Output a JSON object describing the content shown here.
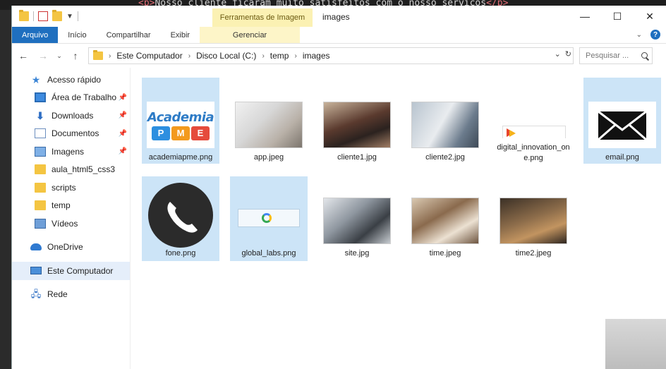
{
  "editor_line": {
    "text": "Nosso cliente ficaram muito satisfeitos com o nosso serviços"
  },
  "window": {
    "title": "images",
    "context_tab_header": "Ferramentas de Imagem"
  },
  "ribbon": {
    "tabs": [
      {
        "label": "Arquivo"
      },
      {
        "label": "Início"
      },
      {
        "label": "Compartilhar"
      },
      {
        "label": "Exibir"
      },
      {
        "label": "Gerenciar"
      }
    ]
  },
  "address": {
    "breadcrumbs": [
      "Este Computador",
      "Disco Local (C:)",
      "temp",
      "images"
    ],
    "search_placeholder": "Pesquisar ..."
  },
  "sidebar": {
    "items": [
      {
        "label": "Acesso rápido",
        "icon": "star-icon",
        "pinned": false
      },
      {
        "label": "Área de Trabalho",
        "icon": "desktop-icon",
        "pinned": true
      },
      {
        "label": "Downloads",
        "icon": "download-icon",
        "pinned": true
      },
      {
        "label": "Documentos",
        "icon": "documents-icon",
        "pinned": true
      },
      {
        "label": "Imagens",
        "icon": "pictures-icon",
        "pinned": true
      },
      {
        "label": "aula_html5_css3",
        "icon": "folder-icon",
        "pinned": false
      },
      {
        "label": "scripts",
        "icon": "folder-icon",
        "pinned": false
      },
      {
        "label": "temp",
        "icon": "folder-icon",
        "pinned": false
      },
      {
        "label": "Vídeos",
        "icon": "videos-icon",
        "pinned": false
      },
      {
        "label": "OneDrive",
        "icon": "cloud-icon",
        "pinned": false
      },
      {
        "label": "Este Computador",
        "icon": "computer-icon",
        "pinned": false
      },
      {
        "label": "Rede",
        "icon": "network-icon",
        "pinned": false
      }
    ]
  },
  "files": [
    {
      "name": "academiapme.png",
      "selected": true
    },
    {
      "name": "app.jpeg",
      "selected": false
    },
    {
      "name": "cliente1.jpg",
      "selected": false
    },
    {
      "name": "cliente2.jpg",
      "selected": false
    },
    {
      "name": "digital_innovation_one.png",
      "selected": false
    },
    {
      "name": "email.png",
      "selected": true
    },
    {
      "name": "fone.png",
      "selected": true
    },
    {
      "name": "global_labs.png",
      "selected": true
    },
    {
      "name": "site.jpg",
      "selected": false
    },
    {
      "name": "time.jpeg",
      "selected": false
    },
    {
      "name": "time2.jpeg",
      "selected": false
    }
  ],
  "logo_text": {
    "academia": "Academia",
    "p": "P",
    "m": "M",
    "e": "E"
  },
  "colors": {
    "file_tab": "#1f6fbf",
    "selection": "#cce4f7",
    "context_tab": "#fbf1b3"
  }
}
